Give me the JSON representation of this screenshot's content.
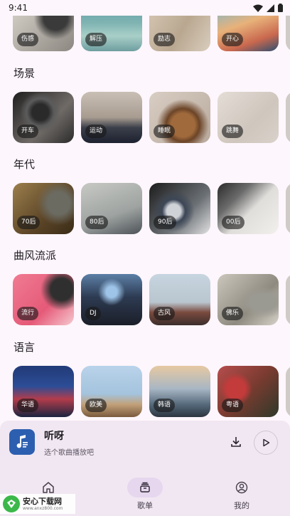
{
  "status_bar": {
    "time": "9:41"
  },
  "sections": [
    {
      "title": "",
      "cards": [
        {
          "label": "伤感",
          "style": "g-shanggan"
        },
        {
          "label": "解压",
          "style": "g-jieya"
        },
        {
          "label": "励志",
          "style": "g-lizhi"
        },
        {
          "label": "开心",
          "style": "g-kaixin"
        }
      ]
    },
    {
      "title": "场景",
      "cards": [
        {
          "label": "开车",
          "style": "g-kaiche"
        },
        {
          "label": "运动",
          "style": "g-yundong"
        },
        {
          "label": "睡眠",
          "style": "g-shuimian"
        },
        {
          "label": "跳舞",
          "style": "g-tiaowu"
        }
      ]
    },
    {
      "title": "年代",
      "cards": [
        {
          "label": "70后",
          "style": "g-70"
        },
        {
          "label": "80后",
          "style": "g-80"
        },
        {
          "label": "90后",
          "style": "g-90"
        },
        {
          "label": "00后",
          "style": "g-00"
        }
      ]
    },
    {
      "title": "曲风流派",
      "cards": [
        {
          "label": "流行",
          "style": "g-liuxing"
        },
        {
          "label": "DJ",
          "style": "g-dj"
        },
        {
          "label": "古风",
          "style": "g-gufeng"
        },
        {
          "label": "佛乐",
          "style": "g-fole"
        }
      ]
    },
    {
      "title": "语言",
      "cards": [
        {
          "label": "华语",
          "style": "g-huayu"
        },
        {
          "label": "欧美",
          "style": "g-oumei"
        },
        {
          "label": "韩语",
          "style": "g-hanyu"
        },
        {
          "label": "粤语",
          "style": "g-yueyu"
        }
      ]
    }
  ],
  "player": {
    "title": "听呀",
    "subtitle": "选个歌曲播放吧",
    "art_icon": "music-note-icon",
    "download_icon": "download-icon",
    "play_icon": "play-icon"
  },
  "bottom_nav": [
    {
      "label": "",
      "icon": "home-icon",
      "active": false
    },
    {
      "label": "歌单",
      "icon": "playlist-icon",
      "active": true
    },
    {
      "label": "我的",
      "icon": "profile-icon",
      "active": false
    }
  ],
  "watermark": {
    "name": "安心下载网",
    "url": "www.anxz800.com"
  },
  "colors": {
    "background": "#fdf6fc",
    "surface": "#f1e7f2",
    "active_indicator": "#e6d7ef",
    "accent": "#2d5fb0"
  }
}
